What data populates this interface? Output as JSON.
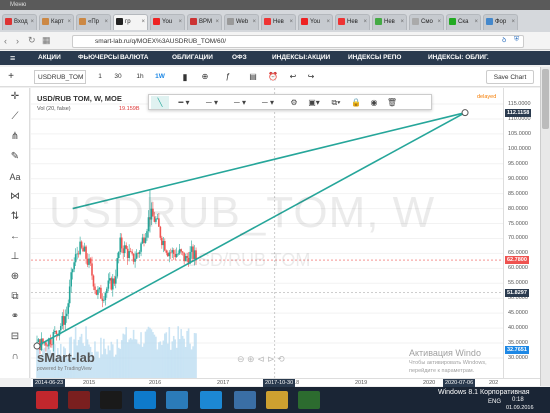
{
  "titlebar": {
    "label": "Меню"
  },
  "tabs": [
    {
      "label": "Вход",
      "color": "#d33"
    },
    {
      "label": "Карт",
      "color": "#c84"
    },
    {
      "label": "«Пр",
      "color": "#c84"
    },
    {
      "label": "гр",
      "color": "#222"
    },
    {
      "label": "You",
      "color": "#e22"
    },
    {
      "label": "BPM",
      "color": "#c33"
    },
    {
      "label": "Web",
      "color": "#999"
    },
    {
      "label": "Нев",
      "color": "#e33"
    },
    {
      "label": "You",
      "color": "#e22"
    },
    {
      "label": "Нев",
      "color": "#e33"
    },
    {
      "label": "Нев",
      "color": "#4a4"
    },
    {
      "label": "Смо",
      "color": "#aaa"
    },
    {
      "label": "Ска",
      "color": "#2a2"
    },
    {
      "label": "Фор",
      "color": "#48c"
    }
  ],
  "address": {
    "url": "smart-lab.ru/q/MOEX%3AUSDRUB_TOM/60/"
  },
  "nav": {
    "menu_icon": "≡",
    "items": [
      "АКЦИИ",
      "ФЬЮЧЕРСЫ",
      "ВАЛЮТА",
      "ОБЛИГАЦИИ",
      "ОФЗ",
      "ИНДЕКСЫ:АКЦИИ",
      "ИНДЕКСЫ РЕПО",
      "ИНДЕКСЫ: ОБЛИГ."
    ]
  },
  "toolbar": {
    "symbol": "USDRUB_TOM",
    "intervals": [
      "1",
      "30",
      "1h",
      "1W"
    ],
    "save": "Save Chart"
  },
  "legend": {
    "title": "USD/RUB TOM, W, MOE",
    "volume": "Vol (20, false)",
    "volume_value": "19.159B",
    "status": "delayed"
  },
  "watermark": {
    "main": "USDRUB_TOM, W",
    "sub": "USD/RUB TOM",
    "logo": "sMart-lab",
    "powered": "powered by TradingView"
  },
  "price_axis": {
    "ticks": [
      "115.0000",
      "110.0000",
      "105.0000",
      "100.0000",
      "95.0000",
      "90.0000",
      "85.0000",
      "80.0000",
      "75.0000",
      "70.0000",
      "65.0000",
      "60.0000",
      "55.0000",
      "50.0000",
      "45.0000",
      "40.0000",
      "35.0000",
      "30.0000"
    ],
    "labels": {
      "top": "112.1158",
      "current": "62.7800",
      "crosshair": "51.8297",
      "bottom": "32.7651"
    }
  },
  "time_axis": {
    "start": "2014-06-23",
    "ticks": [
      "2015",
      "2016",
      "2017",
      "2018",
      "2019",
      "2020"
    ],
    "highlight": "2017-10-30",
    "end_highlight": "2020-07-06",
    "end": "202"
  },
  "activation": {
    "line1": "Активация Windo",
    "line2": "Чтобы активировать Windows,",
    "line3": "перейдите к параметрам."
  },
  "taskbar": {
    "os": "Windows 8.1 Корпоративная",
    "lang": "ENG",
    "time": "0:18",
    "date": "01.09.2016"
  },
  "colors": {
    "trendline": "#26a69a",
    "up": "#26a69a",
    "down": "#ef5350",
    "volume": "#b4d8f0",
    "nav": "#2a3a4e"
  },
  "chart_data": {
    "type": "candlestick",
    "title": "USD/RUB TOM, W, MOE",
    "x_range": [
      "2014-06-23",
      "2020-07-06"
    ],
    "ylim": [
      30,
      115
    ],
    "price_series": [
      [
        "2014-06",
        34.5
      ],
      [
        "2014-07",
        35.0
      ],
      [
        "2014-08",
        36.0
      ],
      [
        "2014-09",
        38.0
      ],
      [
        "2014-10",
        41.0
      ],
      [
        "2014-11",
        45.0
      ],
      [
        "2014-12",
        60.0
      ],
      [
        "2015-01",
        67.0
      ],
      [
        "2015-02",
        65.0
      ],
      [
        "2015-03",
        60.0
      ],
      [
        "2015-04",
        52.0
      ],
      [
        "2015-05",
        51.0
      ],
      [
        "2015-06",
        54.0
      ],
      [
        "2015-07",
        56.0
      ],
      [
        "2015-08",
        68.0
      ],
      [
        "2015-09",
        66.0
      ],
      [
        "2015-10",
        63.0
      ],
      [
        "2015-11",
        65.0
      ],
      [
        "2015-12",
        71.0
      ],
      [
        "2016-01",
        78.0
      ],
      [
        "2016-02",
        76.0
      ],
      [
        "2016-03",
        70.0
      ],
      [
        "2016-04",
        66.0
      ],
      [
        "2016-05",
        65.0
      ],
      [
        "2016-06",
        65.0
      ],
      [
        "2016-07",
        63.0
      ],
      [
        "2016-08",
        65.0
      ],
      [
        "2016-09",
        63.0
      ]
    ],
    "trendlines": [
      {
        "from": [
          "2014-06",
          34.0
        ],
        "to": [
          "2016-09",
          49.5
        ],
        "extended_to": [
          "2020-06",
          112.1
        ]
      },
      {
        "from": [
          "2014-12",
          80.0
        ],
        "to": [
          "2016-01",
          86.0
        ],
        "extended_to": [
          "2020-06",
          112.1
        ]
      }
    ],
    "last_price": 62.78,
    "volume_last": "19.159B"
  }
}
